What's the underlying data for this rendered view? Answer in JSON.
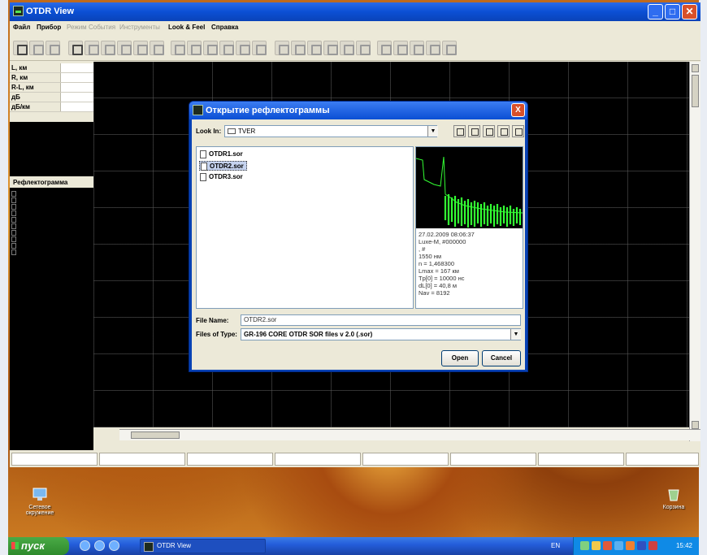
{
  "window": {
    "title": "OTDR View"
  },
  "menu": [
    {
      "label": "Файл",
      "enabled": true
    },
    {
      "label": "Прибор",
      "enabled": true
    },
    {
      "label": "Режим",
      "enabled": false
    },
    {
      "label": "События",
      "enabled": false
    },
    {
      "label": "Инструменты",
      "enabled": false
    },
    {
      "label": "Look & Feel",
      "enabled": true
    },
    {
      "label": "Справка",
      "enabled": true
    }
  ],
  "params": [
    {
      "label": "L, км"
    },
    {
      "label": "R, км"
    },
    {
      "label": "R-L, км"
    },
    {
      "label": "дБ"
    },
    {
      "label": "дБ/км"
    }
  ],
  "reflectogram_header": "Рефлектограмма",
  "dialog": {
    "title": "Открытие рефлектограммы",
    "look_in_label": "Look In:",
    "look_in_value": "TVER",
    "files": [
      {
        "name": "OTDR1.sor",
        "selected": false
      },
      {
        "name": "OTDR2.sor",
        "selected": true
      },
      {
        "name": "OTDR3.sor",
        "selected": false
      }
    ],
    "preview_info": [
      "27.02.2009   08:06:37",
      "Luxe-M, #000000",
      ", #",
      "1550 нм",
      "n = 1,468300",
      "Lmax = 167 км",
      "Tp[0] = 10000 нс",
      "dL[0] = 40,8 м",
      "Nav = 8192"
    ],
    "file_name_label": "File Name:",
    "file_name_value": "OTDR2.sor",
    "files_of_type_label": "Files of Type:",
    "files_of_type_value": "GR-196 CORE OTDR SOR files v 2.0 (.sor)",
    "open_label": "Open",
    "cancel_label": "Cancel",
    "close_label": "X"
  },
  "desktop": {
    "icons": [
      {
        "label": "Сетевое окружение",
        "icon": "network-icon"
      },
      {
        "label": "Корзина",
        "icon": "recycle-bin-icon"
      }
    ]
  },
  "taskbar": {
    "start_label": "пуск",
    "task_label": "OTDR View",
    "language": "EN",
    "time": "15:42"
  },
  "colors": {
    "titlebar": "#0b4fd4",
    "trace": "#33ff33",
    "plot_bg": "#000000",
    "close": "#d8502a"
  }
}
